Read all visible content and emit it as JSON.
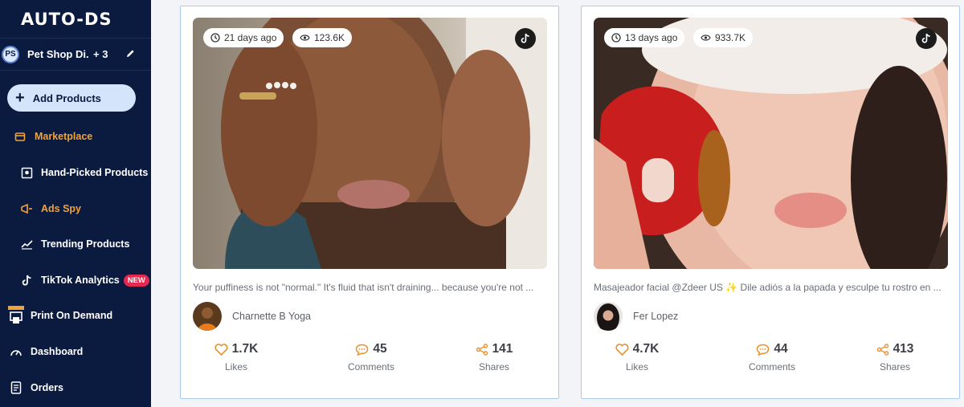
{
  "app": {
    "logo": "AUTO-DS"
  },
  "store": {
    "initials": "PS",
    "name": "Pet Shop Di...",
    "count": "+ 3"
  },
  "sidebar": {
    "add_products": "Add Products",
    "items": [
      {
        "label": "Marketplace",
        "icon": "store-icon"
      },
      {
        "label": "Hand-Picked Products",
        "icon": "hand-picked-icon"
      },
      {
        "label": "Ads Spy",
        "icon": "megaphone-icon"
      },
      {
        "label": "Trending Products",
        "icon": "trending-icon"
      },
      {
        "label": "TikTok Analytics",
        "icon": "tiktok-icon",
        "badge": "NEW"
      },
      {
        "label": "Print On Demand",
        "icon": "print-icon"
      },
      {
        "label": "Dashboard",
        "icon": "dashboard-icon"
      },
      {
        "label": "Orders",
        "icon": "orders-icon"
      }
    ]
  },
  "colors": {
    "sidebar_bg": "#0b1b3f",
    "accent": "#f2a23a",
    "card_border": "#a9c9ef",
    "badge": "#e3294f"
  },
  "cards": [
    {
      "age": "21 days ago",
      "views": "123.6K",
      "caption": "Your puffiness is not \"normal.\" It's fluid that isn't draining... because you're not ...",
      "author": "Charnette B Yoga",
      "likes": "1.7K",
      "comments": "45",
      "shares": "141",
      "likes_label": "Likes",
      "comments_label": "Comments",
      "shares_label": "Shares"
    },
    {
      "age": "13 days ago",
      "views": "933.7K",
      "caption": "Masajeador facial @Zdeer US ✨ Dile adiós a la papada y esculpe tu rostro en ...",
      "author": "Fer Lopez",
      "likes": "4.7K",
      "comments": "44",
      "shares": "413",
      "likes_label": "Likes",
      "comments_label": "Comments",
      "shares_label": "Shares"
    }
  ]
}
